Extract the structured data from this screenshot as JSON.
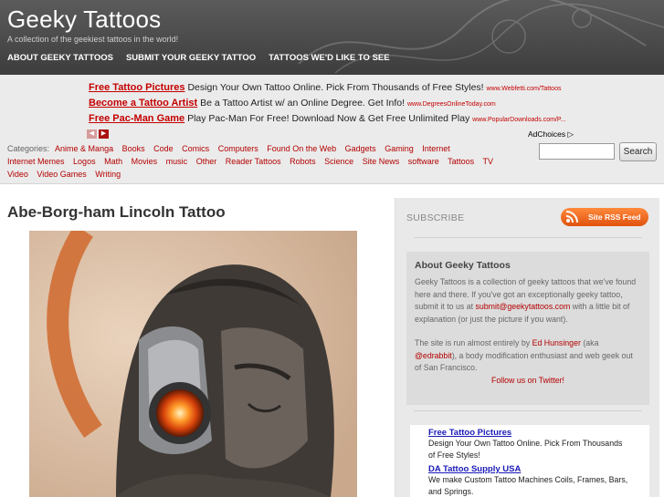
{
  "header": {
    "title": "Geeky Tattoos",
    "tagline": "A collection of the geekiest tattoos in the world!",
    "nav": [
      "ABOUT GEEKY TATTOOS",
      "SUBMIT YOUR GEEKY TATTOO",
      "TATTOOS WE'D LIKE TO SEE"
    ]
  },
  "ads": [
    {
      "title": "Free Tattoo Pictures",
      "text": "Design Your Own Tattoo Online. Pick From Thousands of Free Styles!",
      "url": "www.Webfetti.com/Tattoos"
    },
    {
      "title": "Become a Tattoo Artist",
      "text": "Be a Tattoo Artist w/ an Online Degree. Get Info!",
      "url": "www.DegreesOnlineToday.com"
    },
    {
      "title": "Free Pac-Man Game",
      "text": "Play Pac-Man For Free! Download Now & Get Free Unlimited Play",
      "url": "www.PopularDownloads.com/P..."
    }
  ],
  "adchoices": "AdChoices",
  "categories": {
    "label": "Categories:",
    "items": [
      "Anime & Manga",
      "Books",
      "Code",
      "Comics",
      "Computers",
      "Found On the Web",
      "Gadgets",
      "Gaming",
      "Internet",
      "Internet Memes",
      "Logos",
      "Math",
      "Movies",
      "music",
      "Other",
      "Reader Tattoos",
      "Robots",
      "Science",
      "Site News",
      "software",
      "Tattoos",
      "TV",
      "Video",
      "Video Games",
      "Writing"
    ]
  },
  "search": {
    "button": "Search",
    "value": ""
  },
  "post": {
    "title": "Abe-Borg-ham Lincoln Tattoo"
  },
  "sidebar": {
    "subscribe": "SUBSCRIBE",
    "rss_label": "Site RSS Feed",
    "about_title": "About Geeky Tattoos",
    "about_p1_a": "Geeky Tattoos is a collection of geeky tattoos that we've found here and there. If you've got an exceptionally geeky tattoo, submit it to us at ",
    "about_email": "submit@geekytattoos.com",
    "about_p1_b": " with a little bit of explanation (or just the picture if you want).",
    "about_p2_a": "The site is run almost entirely by ",
    "about_author": "Ed Hunsinger",
    "about_p2_b": " (aka ",
    "about_handle": "@edrabbit",
    "about_p2_c": "), a body modification enthusiast and web geek out of San Francisco.",
    "twitter": "Follow us on Twitter!",
    "ads": [
      {
        "title": "Free Tattoo Pictures",
        "text": "Design Your Own Tattoo Online. Pick From Thousands of Free Styles!"
      },
      {
        "title": "DA Tattoo Supply USA",
        "text": "We make Custom Tattoo Machines Coils, Frames, Bars, and Springs."
      }
    ]
  }
}
